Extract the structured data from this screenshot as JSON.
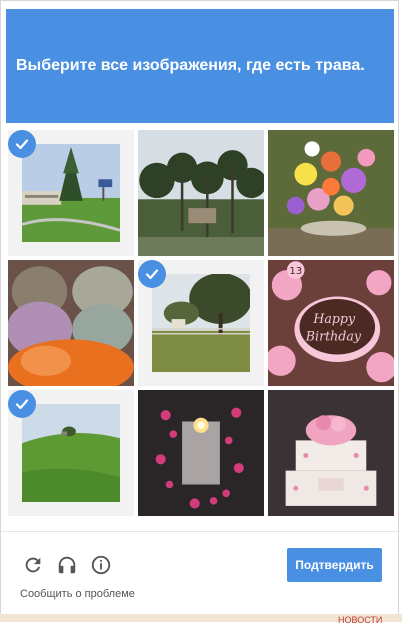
{
  "header": {
    "instruction": "Выберите все изображения, где есть ",
    "keyword": "трава",
    "period": "."
  },
  "tiles": [
    {
      "name": "tile-house-tree-lawn",
      "selected": true,
      "depicts": "house with tree and lawn"
    },
    {
      "name": "tile-palm-trees",
      "selected": false,
      "depicts": "palm trees"
    },
    {
      "name": "tile-flower-bouquet",
      "selected": false,
      "depicts": "flower bouquet"
    },
    {
      "name": "tile-dried-flowers",
      "selected": false,
      "depicts": "bags of dried flowers"
    },
    {
      "name": "tile-field-tree-fence",
      "selected": true,
      "depicts": "field with tree and fence"
    },
    {
      "name": "tile-birthday-cake",
      "selected": false,
      "depicts": "birthday cupcake"
    },
    {
      "name": "tile-green-hill",
      "selected": true,
      "depicts": "green grassy hill"
    },
    {
      "name": "tile-candle-vase",
      "selected": false,
      "depicts": "candle vase with petals"
    },
    {
      "name": "tile-wedding-cake",
      "selected": false,
      "depicts": "white cake with pink flowers"
    }
  ],
  "footer": {
    "reload_icon": "reload-icon",
    "audio_icon": "headphones-icon",
    "info_icon": "info-icon",
    "report_label": "Сообщить о проблеме",
    "verify_label": "Подтвердить"
  },
  "background": {
    "partial_text": "НОВОСТИ"
  },
  "colors": {
    "accent": "#4a90e2",
    "header_bg": "#4a90e2"
  }
}
